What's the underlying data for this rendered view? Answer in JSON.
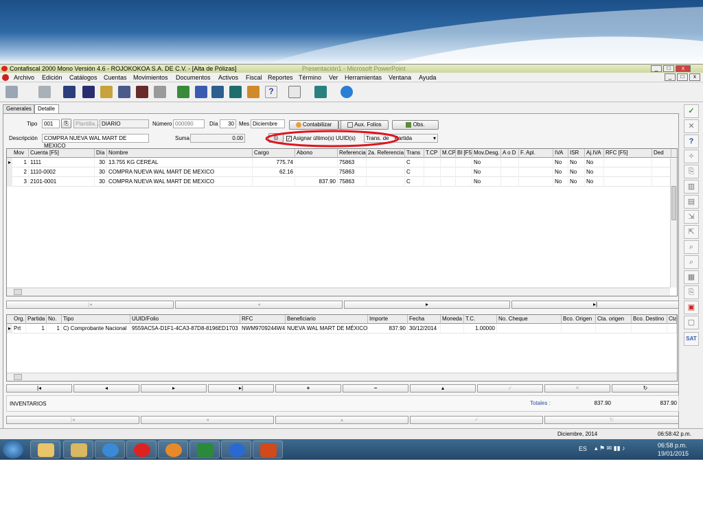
{
  "window": {
    "title": "Contafiscal 2000 Mono Versión 4.6 - ROJOKOKOA S.A. DE C.V. - [Alta de Pólizas]",
    "background_title": "Presentación1 - Microsoft PowerPoint"
  },
  "menu": [
    "Archivo",
    "Edición",
    "Catálogos",
    "Cuentas",
    "Movimientos",
    "Documentos",
    "Activos",
    "Fiscal",
    "Reportes",
    "Término",
    "Ver",
    "Herramientas",
    "Ventana",
    "Ayuda"
  ],
  "tabs": [
    "Generales",
    "Detalle"
  ],
  "header": {
    "tipo_label": "Tipo",
    "tipo_value": "001",
    "plantilla_label": "Plantilla...",
    "tipo_name": "DIARIO",
    "numero_label": "Número",
    "numero_value": "000090",
    "dia_label": "Día",
    "dia_value": "30",
    "mes_label": "Mes",
    "mes_value": "Diciembre",
    "descripcion_label": "Descripción",
    "descripcion_value": "COMPRA NUEVA WAL MART DE MEXICO",
    "suma_label": "Suma",
    "suma_value": "0.00",
    "contabilizar_label": "Contabilizar",
    "aux_folios_label": "Aux. Folios",
    "obs_label": "Obs.",
    "asignar_label": "Asignar último(s) UUID(s)",
    "trans_label": "Trans. de",
    "partida_value": "Partida"
  },
  "movements": {
    "columns": [
      "Mov",
      "Cuenta  [F5]",
      "Día",
      "Nombre",
      "Cargo",
      "Abono",
      "Referencia",
      "2a. Referencia",
      "Trans",
      "T.CP",
      "M.CP",
      "Bl [F5]",
      "Mov.Desg.",
      "A o D",
      "F. Apl.",
      "IVA",
      "ISR",
      "Aj.IVA",
      "RFC  [F5]",
      "Ded"
    ],
    "rows": [
      {
        "mov": "1",
        "cuenta": "1111",
        "dia": "30",
        "nombre": "13.755 KG CEREAL",
        "cargo": "775.74",
        "abono": "",
        "ref": "75863",
        "trans": "C",
        "desg": "No",
        "iva": "No",
        "isr": "No",
        "ajiva": "No"
      },
      {
        "mov": "2",
        "cuenta": "1110-0002",
        "dia": "30",
        "nombre": "COMPRA NUEVA WAL MART DE MEXICO",
        "cargo": "62.16",
        "abono": "",
        "ref": "75863",
        "trans": "C",
        "desg": "No",
        "iva": "No",
        "isr": "No",
        "ajiva": "No"
      },
      {
        "mov": "3",
        "cuenta": "2101-0001",
        "dia": "30",
        "nombre": "COMPRA NUEVA WAL MART DE MEXICO",
        "cargo": "",
        "abono": "837.90",
        "ref": "75863",
        "trans": "C",
        "desg": "No",
        "iva": "No",
        "isr": "No",
        "ajiva": "No"
      }
    ]
  },
  "docs": {
    "columns": [
      "Org.",
      "Partida",
      "No.",
      "Tipo",
      "UUID/Folio",
      "RFC",
      "Beneficiario",
      "Importe",
      "Fecha",
      "Moneda",
      "T.C.",
      "No. Cheque",
      "Bco. Origen",
      "Cta. origen",
      "Bco. Destino",
      "Cta."
    ],
    "rows": [
      {
        "org": "Prt",
        "partida": "1",
        "no": "1",
        "tipo": "C) Comprobante Nacional",
        "uuid": "9559AC5A-D1F1-4CA3-87D8-8196ED1703",
        "rfc": "NWM9709244W4",
        "benef": "NUEVA WAL MART DE MÉXICO,",
        "importe": "837.90",
        "fecha": "30/12/2014",
        "moneda": "",
        "tc": "1.00000"
      }
    ]
  },
  "footer": {
    "concepto": "INVENTARIOS",
    "totales_label": "Totales :",
    "total_cargo": "837.90",
    "total_abono": "837.90"
  },
  "status": {
    "period": "Diciembre, 2014",
    "time": "06:58:42 p.m."
  },
  "taskbar": {
    "lang": "ES",
    "clock_time": "06:58 p.m.",
    "clock_date": "19/01/2015"
  },
  "colors": {
    "annotation_circle": "#e0141e",
    "title_bar": "#d7dfae",
    "ok_check": "#2a9a1e"
  }
}
